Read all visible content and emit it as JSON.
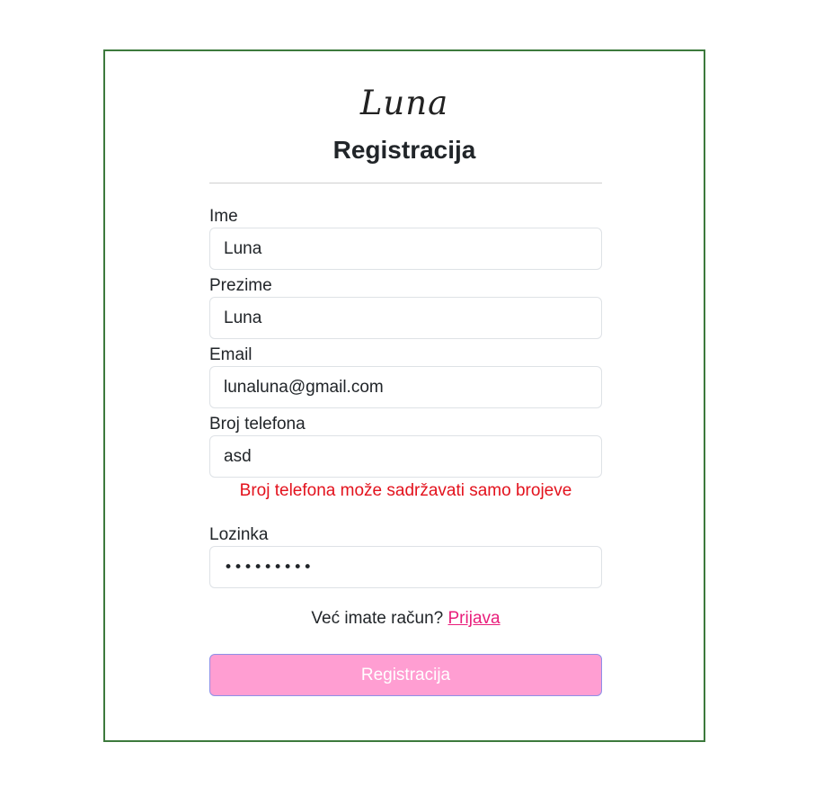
{
  "brand": "Luna",
  "title": "Registracija",
  "fields": {
    "first_name": {
      "label": "Ime",
      "value": "Luna"
    },
    "last_name": {
      "label": "Prezime",
      "value": "Luna"
    },
    "email": {
      "label": "Email",
      "value": "lunaluna@gmail.com"
    },
    "phone": {
      "label": "Broj telefona",
      "value": "asd",
      "error": "Broj telefona može sadržavati samo brojeve"
    },
    "password": {
      "label": "Lozinka",
      "value": "•••••••••"
    }
  },
  "login_prompt": {
    "text": "Već imate račun?",
    "link": "Prijava"
  },
  "submit_label": "Registracija",
  "colors": {
    "card_border": "#3d7a3d",
    "error": "#e3121d",
    "link": "#e91e7b",
    "button_bg": "#ff9ed2",
    "button_border": "#8e8fe8"
  }
}
